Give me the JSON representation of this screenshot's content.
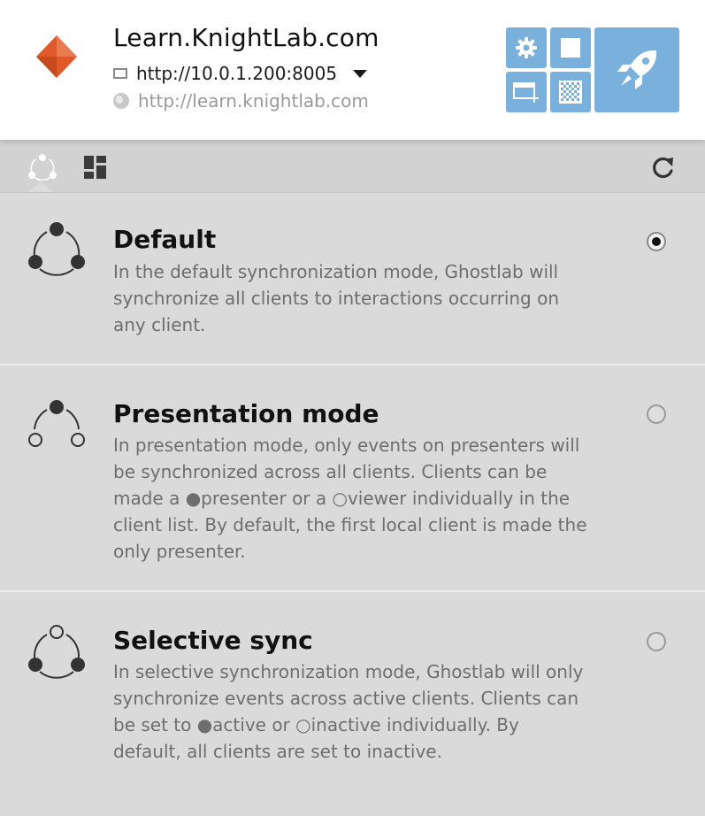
{
  "app": {
    "site_title": "Learn.KnightLab.com",
    "local_url": "http://10.0.1.200:8005",
    "origin_url": "http://learn.knightlab.com",
    "accent_color": "#7ab0dc",
    "logo_color": "#e0592a"
  },
  "toolbar": {
    "settings_icon": "gear-icon",
    "stop_icon": "stop-icon",
    "new_window_icon": "new-window-icon",
    "qr_icon": "qr-code-icon",
    "launch_icon": "rocket-icon"
  },
  "tabs": [
    {
      "icon": "sync-modes-icon",
      "active": true
    },
    {
      "icon": "grid-layout-icon",
      "active": false
    }
  ],
  "refresh_icon": "refresh-icon",
  "modes": [
    {
      "title": "Default",
      "description": "In the default synchronization mode, Ghostlab will synchronize all clients to interactions occurring on any client.",
      "selected": true
    },
    {
      "title": "Presentation mode",
      "description": "In presentation mode, only events on presenters will be synchronized across all clients. Clients can be made a ●presenter or a ○viewer individually in the client list. By default, the first local client is made the only presenter.",
      "selected": false
    },
    {
      "title": "Selective sync",
      "description": "In selective synchronization mode, Ghostlab will only synchronize events across active clients. Clients can be set to ●active or ○inactive individually. By default, all clients are set to inactive.",
      "selected": false
    }
  ]
}
